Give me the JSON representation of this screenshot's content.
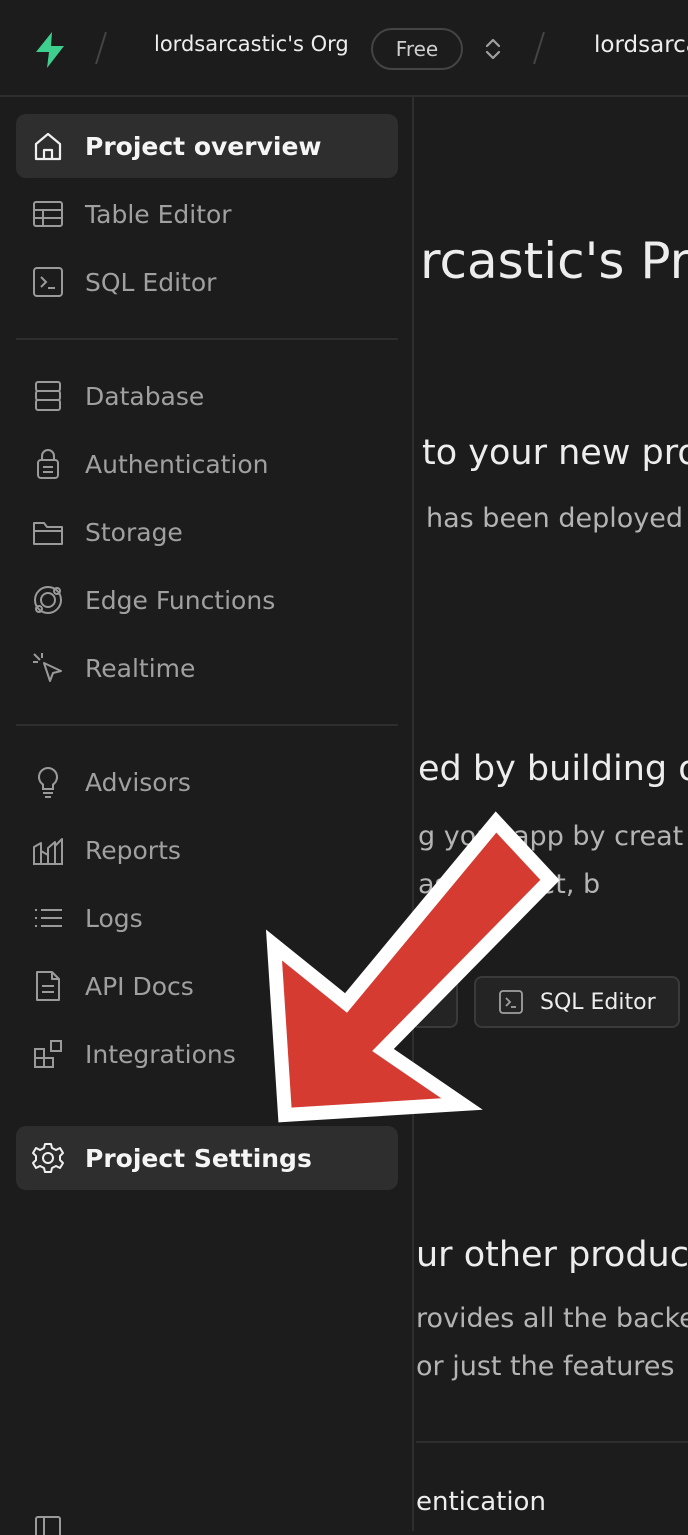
{
  "topbar": {
    "org_name": "lordsarcastic's Org",
    "plan_badge": "Free",
    "project_crumb": "lordsarca"
  },
  "sidebar": {
    "items": [
      {
        "label": "Project overview",
        "icon": "home-icon"
      },
      {
        "label": "Table Editor",
        "icon": "table-icon"
      },
      {
        "label": "SQL Editor",
        "icon": "terminal-icon"
      },
      {
        "label": "Database",
        "icon": "database-icon"
      },
      {
        "label": "Authentication",
        "icon": "lock-icon"
      },
      {
        "label": "Storage",
        "icon": "folder-icon"
      },
      {
        "label": "Edge Functions",
        "icon": "edge-functions-icon"
      },
      {
        "label": "Realtime",
        "icon": "cursor-click-icon"
      },
      {
        "label": "Advisors",
        "icon": "lightbulb-icon"
      },
      {
        "label": "Reports",
        "icon": "reports-icon"
      },
      {
        "label": "Logs",
        "icon": "list-icon"
      },
      {
        "label": "API Docs",
        "icon": "document-icon"
      },
      {
        "label": "Integrations",
        "icon": "integrations-icon"
      },
      {
        "label": "Project Settings",
        "icon": "gear-icon"
      }
    ]
  },
  "main": {
    "project_title": "rcastic's Pr",
    "welcome_heading": "to your new pro",
    "welcome_sub": "has been deployed",
    "start_heading": "ed by building o",
    "start_line1": "g your app by creat",
    "start_line2": "as      adsheet, b",
    "sql_editor_button": "SQL Editor",
    "products_heading": "ur other produc",
    "products_line1": "rovides all the backe",
    "products_line2": "or just the features",
    "auth_heading": "entication"
  },
  "colors": {
    "background": "#1c1c1c",
    "active_item": "#2e2e2e",
    "brand_green": "#3ecf8e",
    "annotation_red": "#d63b32"
  }
}
